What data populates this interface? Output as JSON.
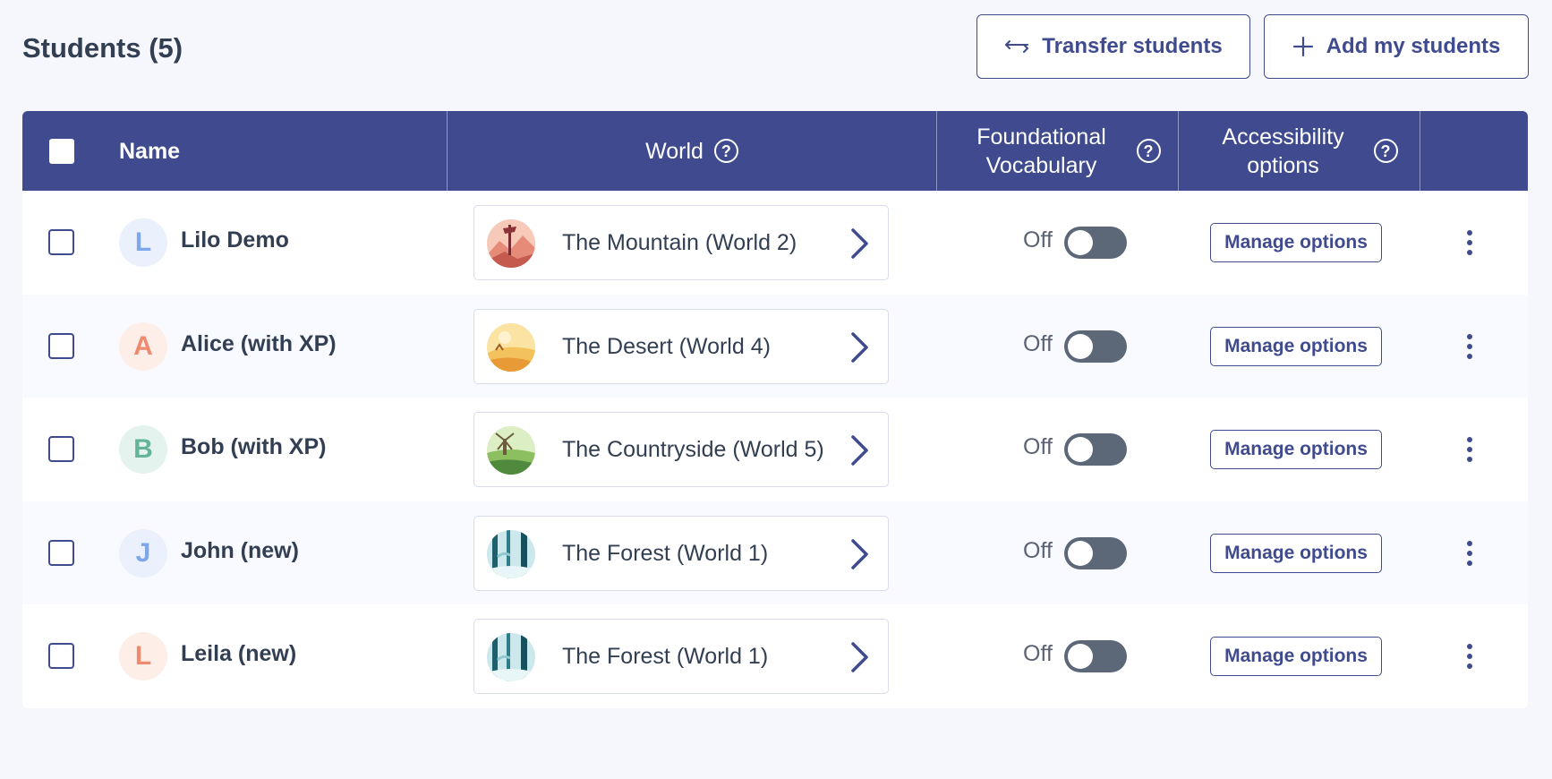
{
  "header": {
    "title": "Students (5)",
    "transfer_label": "Transfer students",
    "add_label": "Add my students"
  },
  "table": {
    "columns": {
      "name": "Name",
      "world": "World",
      "vocab": "Foundational Vocabulary",
      "access": "Accessibility options"
    },
    "rows": [
      {
        "name": "Lilo Demo",
        "avatar_letter": "L",
        "avatar_bg": "#eaf1fd",
        "avatar_color": "#7ea6ea",
        "world": "The Mountain (World 2)",
        "world_theme": "mountain",
        "vocab_state": "Off",
        "manage_label": "Manage options"
      },
      {
        "name": "Alice (with XP)",
        "avatar_letter": "A",
        "avatar_bg": "#fdeee8",
        "avatar_color": "#ee8a6f",
        "world": "The Desert (World 4)",
        "world_theme": "desert",
        "vocab_state": "Off",
        "manage_label": "Manage options"
      },
      {
        "name": "Bob (with XP)",
        "avatar_letter": "B",
        "avatar_bg": "#e4f3ee",
        "avatar_color": "#64b49b",
        "world": "The Countryside (World 5)",
        "world_theme": "countryside",
        "vocab_state": "Off",
        "manage_label": "Manage options"
      },
      {
        "name": "John (new)",
        "avatar_letter": "J",
        "avatar_bg": "#eaf1fd",
        "avatar_color": "#7ea6ea",
        "world": "The Forest (World 1)",
        "world_theme": "forest",
        "vocab_state": "Off",
        "manage_label": "Manage options"
      },
      {
        "name": "Leila (new)",
        "avatar_letter": "L",
        "avatar_bg": "#fdeee8",
        "avatar_color": "#ee8a6f",
        "world": "The Forest (World 1)",
        "world_theme": "forest",
        "vocab_state": "Off",
        "manage_label": "Manage options"
      }
    ]
  },
  "colors": {
    "primary": "#3f4b8e",
    "toggle_off": "#5c6778",
    "background": "#f6f7fc"
  },
  "icons": {
    "transfer": "transfer-arrows-icon",
    "add": "plus-icon",
    "help": "question-circle-icon",
    "world_chevron": "chevron-right-icon",
    "row_menu": "kebab-menu-icon"
  }
}
